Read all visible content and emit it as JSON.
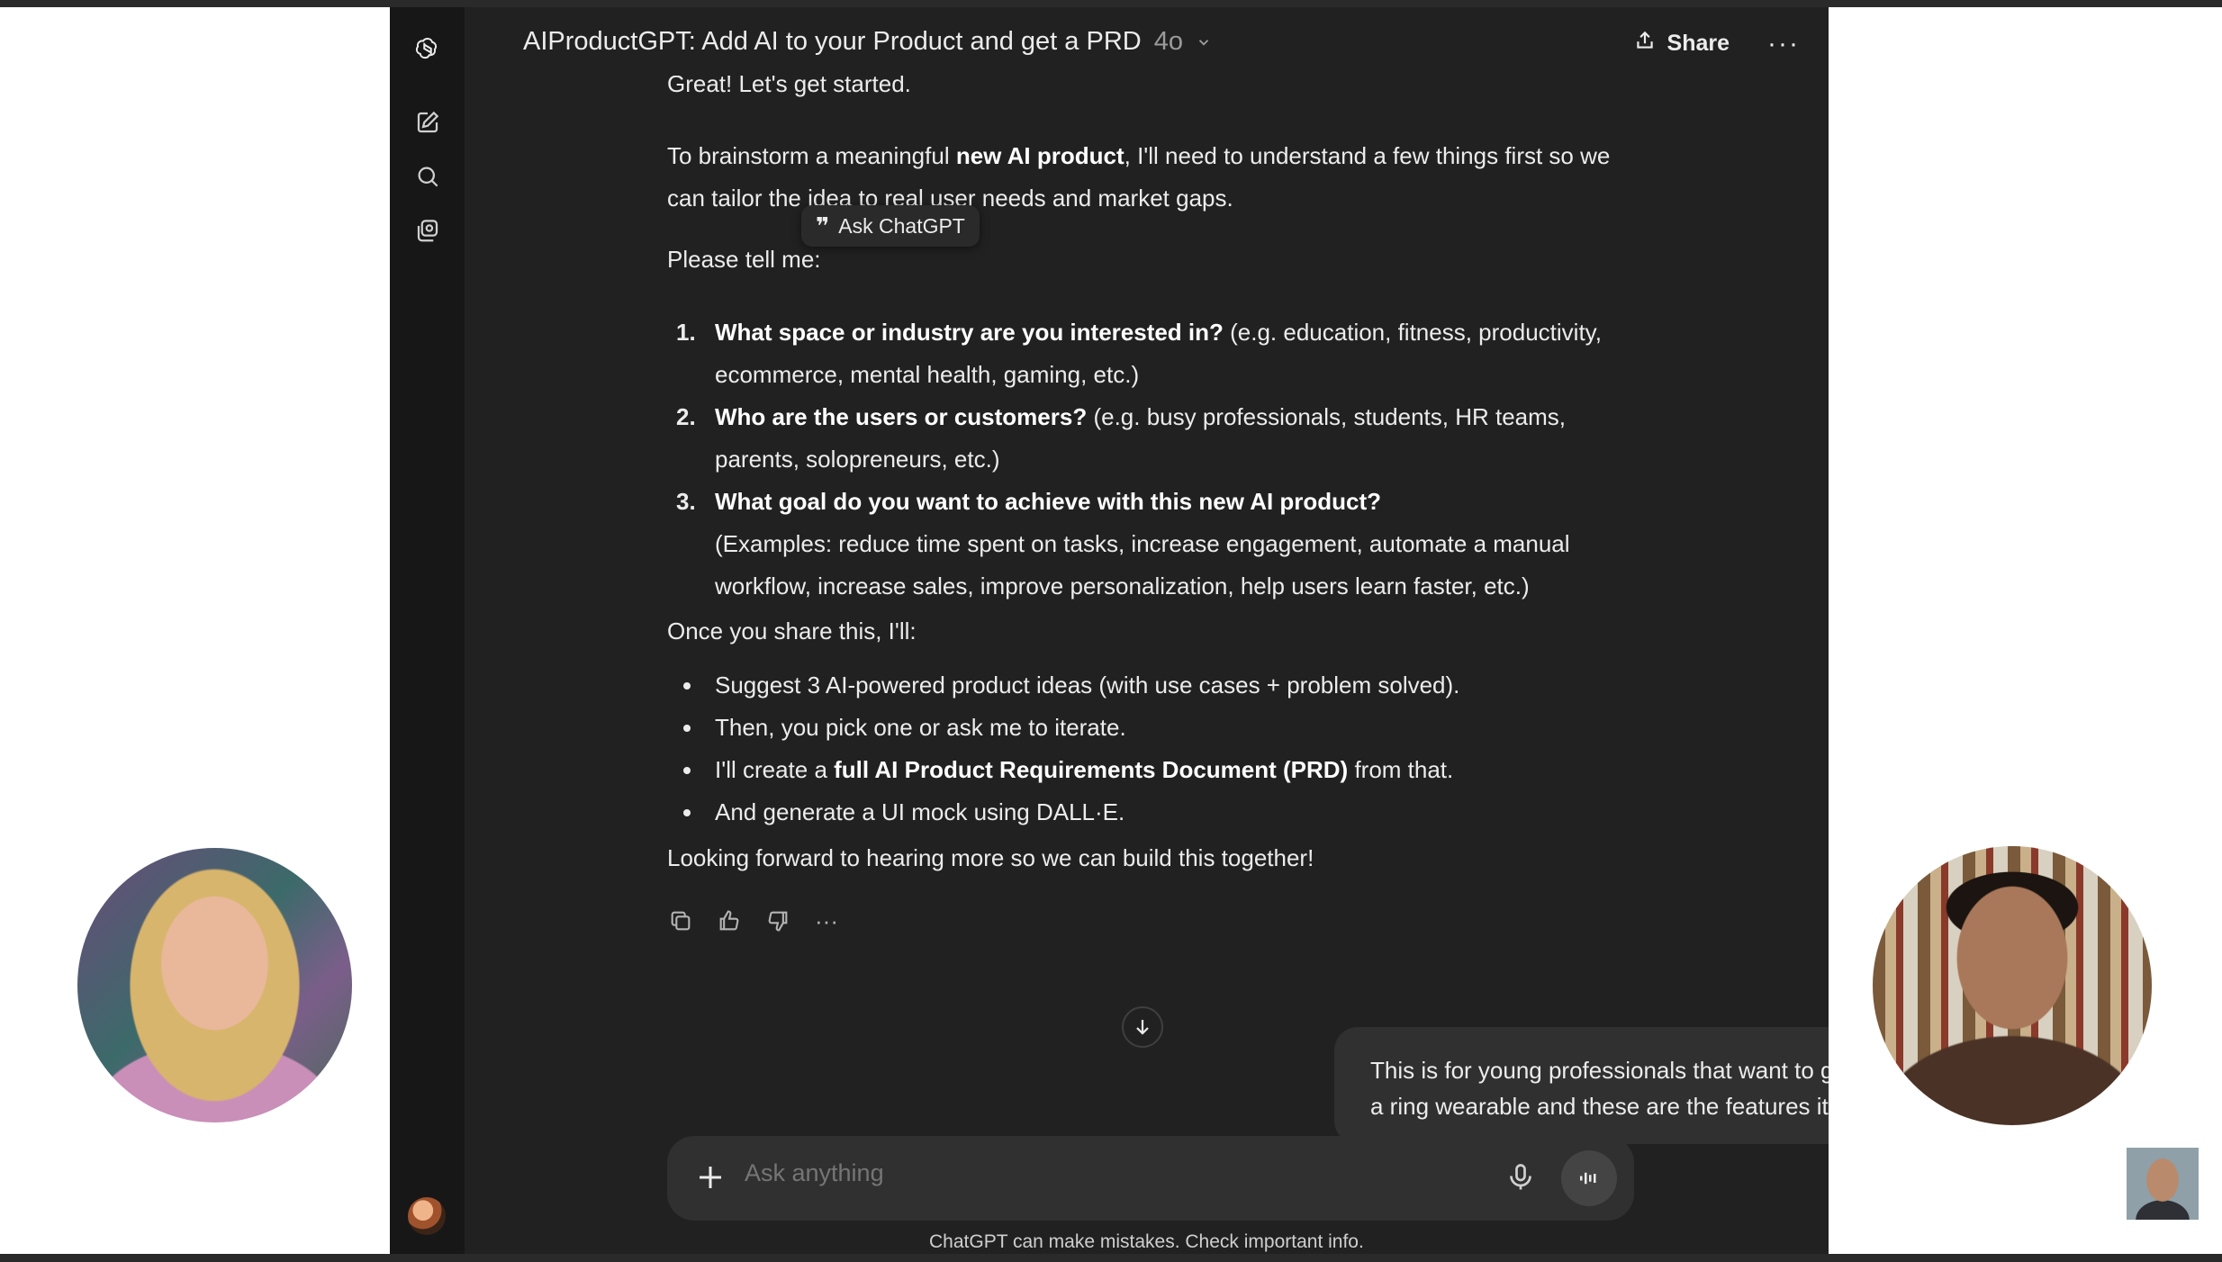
{
  "window": {
    "title": "AIProductGPT: Add AI to your Product and get a PRD",
    "model": "4o",
    "share_label": "Share",
    "more_label": "···"
  },
  "rail": {
    "icons": [
      "chatgpt-logo-icon",
      "new-chat-icon",
      "search-icon",
      "library-icon"
    ]
  },
  "popover": {
    "label": "Ask ChatGPT"
  },
  "message": {
    "clipped_top": "Great! Let's get started.",
    "intro_before": "To brainstorm a meaningful ",
    "intro_bold": "new AI product",
    "intro_after": ", I'll need to understand a few things first so we can tailor the idea to real user needs and market gaps.",
    "tell_me": "Please tell me:",
    "questions": [
      {
        "num": "1.",
        "bold": "What space or industry are you interested in?",
        "rest": " (e.g. education, fitness, productivity, ecommerce, mental health, gaming, etc.)"
      },
      {
        "num": "2.",
        "bold": "Who are the users or customers?",
        "rest": " (e.g. busy professionals, students, HR teams, parents, solopreneurs, etc.)"
      },
      {
        "num": "3.",
        "bold": "What goal do you want to achieve with this new AI product?",
        "rest": "(Examples: reduce time spent on tasks, increase engagement, automate a manual workflow, increase sales, improve personalization, help users learn faster, etc.)"
      }
    ],
    "once": "Once you share this, I'll:",
    "bullets": [
      {
        "before": "Suggest 3 AI-powered product ideas (with use cases + problem solved).",
        "bold": "",
        "after": ""
      },
      {
        "before": "Then, you pick one or ask me to iterate.",
        "bold": "",
        "after": ""
      },
      {
        "before": "I'll create a ",
        "bold": "full AI Product Requirements Document (PRD)",
        "after": " from that."
      },
      {
        "before": "And generate a UI mock using DALL·E.",
        "bold": "",
        "after": ""
      }
    ],
    "closing": "Looking forward to hearing more so we can build this together!"
  },
  "user_message": "This is for young professionals that want to get healthier, it's a ring wearable and these are the features it should have",
  "composer": {
    "placeholder": "Ask anything"
  },
  "disclaimer": "ChatGPT can make mistakes. Check important info.",
  "colors": {
    "background": "#212121",
    "rail": "#171717",
    "bubble": "#303030",
    "text": "#ececec"
  }
}
